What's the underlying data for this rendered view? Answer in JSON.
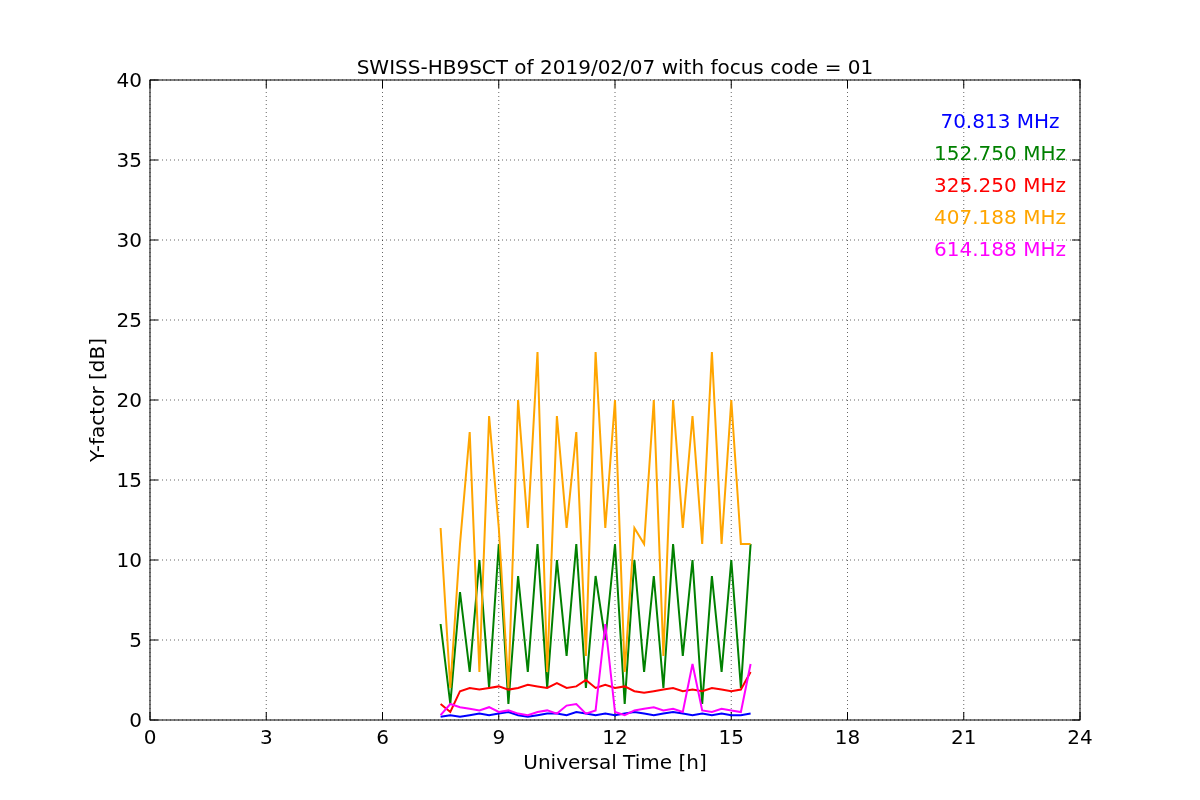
{
  "figure": {
    "chart_data": {
      "type": "line",
      "title": "SWISS-HB9SCT of 2019/02/07 with focus code = 01",
      "xlabel": "Universal Time [h]",
      "ylabel": "Y-factor [dB]",
      "xlim": [
        0,
        24
      ],
      "ylim": [
        0,
        40
      ],
      "xticks": [
        0,
        3,
        6,
        9,
        12,
        15,
        18,
        21,
        24
      ],
      "yticks": [
        0,
        5,
        10,
        15,
        20,
        25,
        30,
        35,
        40
      ],
      "grid": true,
      "x": [
        7.5,
        7.75,
        8,
        8.25,
        8.5,
        8.75,
        9,
        9.25,
        9.5,
        9.75,
        10,
        10.25,
        10.5,
        10.75,
        11,
        11.25,
        11.5,
        11.75,
        12,
        12.25,
        12.5,
        12.75,
        13,
        13.25,
        13.5,
        13.75,
        14,
        14.25,
        14.5,
        14.75,
        15,
        15.25,
        15.5
      ],
      "series": [
        {
          "name": "70.813 MHz",
          "color": "#0000ff",
          "values": [
            0.2,
            0.3,
            0.2,
            0.3,
            0.4,
            0.3,
            0.4,
            0.5,
            0.3,
            0.2,
            0.3,
            0.4,
            0.4,
            0.3,
            0.5,
            0.4,
            0.3,
            0.4,
            0.3,
            0.4,
            0.5,
            0.4,
            0.3,
            0.4,
            0.5,
            0.4,
            0.3,
            0.4,
            0.3,
            0.4,
            0.3,
            0.3,
            0.4
          ]
        },
        {
          "name": "152.750 MHz",
          "color": "#008000",
          "values": [
            6,
            1,
            8,
            3,
            10,
            2,
            11,
            1,
            9,
            3,
            11,
            2,
            10,
            4,
            11,
            2,
            9,
            5,
            11,
            1,
            10,
            3,
            9,
            2,
            11,
            4,
            10,
            1,
            9,
            3,
            10,
            2,
            11
          ]
        },
        {
          "name": "325.250 MHz",
          "color": "#ff0000",
          "values": [
            1,
            0.5,
            1.8,
            2,
            1.9,
            2,
            2.1,
            1.9,
            2,
            2.2,
            2.1,
            2,
            2.3,
            2,
            2.1,
            2.5,
            2,
            2.2,
            2,
            2.1,
            1.8,
            1.7,
            1.8,
            1.9,
            2,
            1.8,
            1.9,
            1.8,
            2,
            1.9,
            1.8,
            1.9,
            3
          ]
        },
        {
          "name": "407.188 MHz",
          "color": "#ffa500",
          "values": [
            12,
            2,
            11,
            18,
            3,
            19,
            12,
            2,
            20,
            12,
            23,
            3,
            19,
            12,
            18,
            4,
            23,
            12,
            20,
            3,
            12,
            11,
            20,
            4,
            20,
            12,
            19,
            11,
            23,
            11,
            20,
            11,
            11
          ]
        },
        {
          "name": "614.188 MHz",
          "color": "#ff00ff",
          "values": [
            0.3,
            1,
            0.8,
            0.7,
            0.6,
            0.8,
            0.5,
            0.6,
            0.4,
            0.3,
            0.5,
            0.6,
            0.4,
            0.9,
            1,
            0.4,
            0.6,
            6,
            0.5,
            0.3,
            0.6,
            0.7,
            0.8,
            0.6,
            0.7,
            0.5,
            3.5,
            0.6,
            0.5,
            0.7,
            0.6,
            0.5,
            3.5
          ]
        }
      ]
    }
  }
}
